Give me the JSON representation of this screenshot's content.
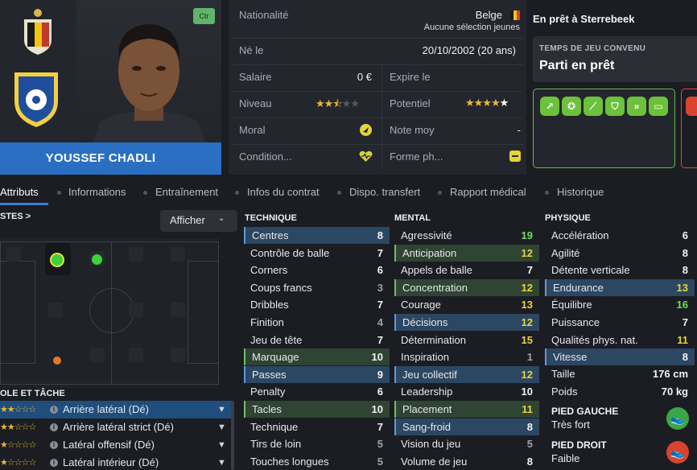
{
  "player": {
    "name": "YOUSSEF CHADLI",
    "position_badge": "Ctr"
  },
  "info": {
    "nationality_label": "Nationalité",
    "nationality_value": "Belge",
    "nationality_sub": "Aucune sélection jeunes",
    "born_label": "Né le",
    "born_value": "20/10/2002 (20 ans)",
    "salary_label": "Salaire",
    "salary_value": "0 €",
    "expires_label": "Expire le",
    "level_label": "Niveau",
    "level_stars": 2.5,
    "potential_label": "Potentiel",
    "potential_stars": 5,
    "morale_label": "Moral",
    "avg_rating_label": "Note moy",
    "avg_rating_value": "-",
    "condition_label": "Condition...",
    "form_label": "Forme ph..."
  },
  "loan": {
    "title": "En prêt à Sterrebeek",
    "playing_time_head": "TEMPS DE JEU CONVENU",
    "playing_time_value": "Parti en prêt"
  },
  "traits": [
    "trend-up-icon",
    "brain-icon",
    "bandage-icon",
    "shield-icon",
    "wings-icon",
    "pitch-icon"
  ],
  "tabs": [
    "Attributs",
    "Informations",
    "Entraînement",
    "Infos du contrat",
    "Dispo. transfert",
    "Rapport médical",
    "Historique"
  ],
  "positions": {
    "header": "STES >",
    "display_button": "Afficher"
  },
  "roles": {
    "header": "OLE ET TÂCHE",
    "items": [
      {
        "label": "Arrière latéral (Dé)",
        "stars": "★★☆☆☆",
        "selected": true
      },
      {
        "label": "Arrière latéral strict (Dé)",
        "stars": "★★☆☆☆",
        "selected": false
      },
      {
        "label": "Latéral offensif (Dé)",
        "stars": "★☆☆☆☆",
        "selected": false
      },
      {
        "label": "Latéral intérieur (Dé)",
        "stars": "★☆☆☆☆",
        "selected": false
      }
    ]
  },
  "technique": {
    "header": "TECHNIQUE",
    "attrs": [
      {
        "name": "Centres",
        "value": "8",
        "hl": "blue",
        "c": "white"
      },
      {
        "name": "Contrôle de balle",
        "value": "7",
        "hl": "",
        "c": "white"
      },
      {
        "name": "Corners",
        "value": "6",
        "hl": "",
        "c": "white"
      },
      {
        "name": "Coups francs",
        "value": "3",
        "hl": "",
        "c": "grey"
      },
      {
        "name": "Dribbles",
        "value": "7",
        "hl": "",
        "c": "white"
      },
      {
        "name": "Finition",
        "value": "4",
        "hl": "",
        "c": "grey"
      },
      {
        "name": "Jeu de tête",
        "value": "7",
        "hl": "",
        "c": "white"
      },
      {
        "name": "Marquage",
        "value": "10",
        "hl": "green",
        "c": "white"
      },
      {
        "name": "Passes",
        "value": "9",
        "hl": "blue",
        "c": "white"
      },
      {
        "name": "Penalty",
        "value": "6",
        "hl": "",
        "c": "white"
      },
      {
        "name": "Tacles",
        "value": "10",
        "hl": "green",
        "c": "white"
      },
      {
        "name": "Technique",
        "value": "7",
        "hl": "",
        "c": "white"
      },
      {
        "name": "Tirs de loin",
        "value": "5",
        "hl": "",
        "c": "grey"
      },
      {
        "name": "Touches longues",
        "value": "5",
        "hl": "",
        "c": "grey"
      }
    ]
  },
  "mental": {
    "header": "MENTAL",
    "attrs": [
      {
        "name": "Agressivité",
        "value": "19",
        "hl": "",
        "c": "green"
      },
      {
        "name": "Anticipation",
        "value": "12",
        "hl": "green",
        "c": "yellow"
      },
      {
        "name": "Appels de balle",
        "value": "7",
        "hl": "",
        "c": "white"
      },
      {
        "name": "Concentration",
        "value": "12",
        "hl": "green",
        "c": "yellow"
      },
      {
        "name": "Courage",
        "value": "13",
        "hl": "",
        "c": "yellow"
      },
      {
        "name": "Décisions",
        "value": "12",
        "hl": "blue",
        "c": "yellow"
      },
      {
        "name": "Détermination",
        "value": "15",
        "hl": "",
        "c": "yellow"
      },
      {
        "name": "Inspiration",
        "value": "1",
        "hl": "",
        "c": "grey"
      },
      {
        "name": "Jeu collectif",
        "value": "12",
        "hl": "blue",
        "c": "yellow"
      },
      {
        "name": "Leadership",
        "value": "10",
        "hl": "",
        "c": "white"
      },
      {
        "name": "Placement",
        "value": "11",
        "hl": "green",
        "c": "yellow"
      },
      {
        "name": "Sang-froid",
        "value": "8",
        "hl": "blue",
        "c": "white"
      },
      {
        "name": "Vision du jeu",
        "value": "5",
        "hl": "",
        "c": "grey"
      },
      {
        "name": "Volume de jeu",
        "value": "8",
        "hl": "",
        "c": "white"
      }
    ]
  },
  "physique": {
    "header": "PHYSIQUE",
    "attrs": [
      {
        "name": "Accélération",
        "value": "6",
        "hl": "",
        "c": "white"
      },
      {
        "name": "Agilité",
        "value": "8",
        "hl": "",
        "c": "white"
      },
      {
        "name": "Détente verticale",
        "value": "8",
        "hl": "",
        "c": "white"
      },
      {
        "name": "Endurance",
        "value": "13",
        "hl": "blue",
        "c": "yellow"
      },
      {
        "name": "Équilibre",
        "value": "16",
        "hl": "",
        "c": "green"
      },
      {
        "name": "Puissance",
        "value": "7",
        "hl": "",
        "c": "white"
      },
      {
        "name": "Qualités phys. nat.",
        "value": "11",
        "hl": "",
        "c": "yellow"
      },
      {
        "name": "Vitesse",
        "value": "8",
        "hl": "blue",
        "c": "white"
      }
    ],
    "height_label": "Taille",
    "height_value": "176 cm",
    "weight_label": "Poids",
    "weight_value": "70 kg",
    "left_foot_label": "PIED GAUCHE",
    "left_foot_value": "Très fort",
    "right_foot_label": "PIED DROIT",
    "right_foot_value": "Faible"
  }
}
